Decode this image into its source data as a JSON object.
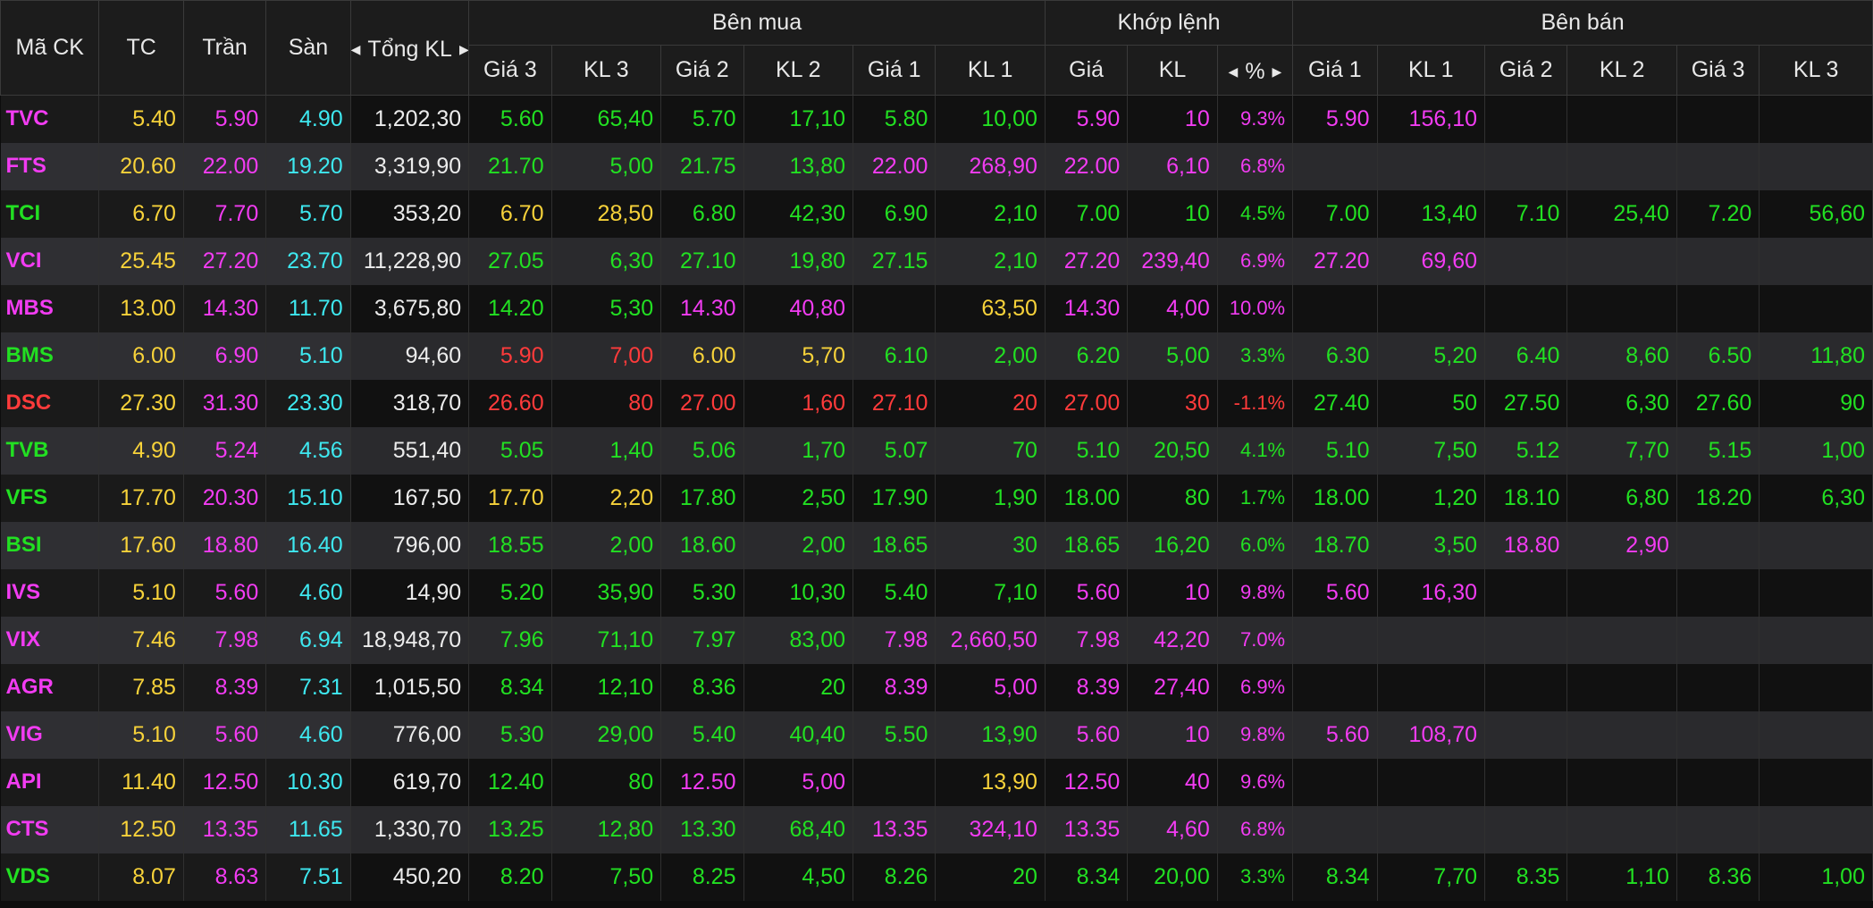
{
  "headers": {
    "symbol": "Mã CK",
    "ref": "TC",
    "ceiling": "Trần",
    "floor": "Sàn",
    "total_volume": "Tổng KL",
    "buy_group": "Bên mua",
    "match_group": "Khớp lệnh",
    "sell_group": "Bên bán",
    "buy_cols": [
      "Giá 3",
      "KL 3",
      "Giá 2",
      "KL 2",
      "Giá 1",
      "KL 1"
    ],
    "match_cols": [
      "Giá",
      "KL",
      "%"
    ],
    "sell_cols": [
      "Giá 1",
      "KL 1",
      "Giá 2",
      "KL 2",
      "Giá 3",
      "KL 3"
    ]
  },
  "icons": {
    "left": "arrow-left-icon",
    "right": "arrow-right-icon"
  },
  "colors": {
    "up": "#22e022",
    "down": "#ff3b3b",
    "ref": "#f7d23a",
    "ceiling": "#f23cf2",
    "floor": "#3ee8f0",
    "header_bg": "#1c1c1c",
    "row_dark": "#111111",
    "row_light": "#2a2a2d"
  },
  "rows": [
    {
      "s": "TVC",
      "sc": "c",
      "tc": "5.40",
      "tran": "5.90",
      "san": "4.90",
      "tkl": "1,202,30",
      "buy": [
        [
          "5.60",
          "u"
        ],
        [
          "65,40",
          "u"
        ],
        [
          "5.70",
          "u"
        ],
        [
          "17,10",
          "u"
        ],
        [
          "5.80",
          "u"
        ],
        [
          "10,00",
          "u"
        ]
      ],
      "match": [
        [
          "5.90",
          "c"
        ],
        [
          "10",
          "c"
        ],
        [
          "9.3%",
          "c"
        ]
      ],
      "sell": [
        [
          "5.90",
          "c"
        ],
        [
          "156,10",
          "c"
        ],
        [
          "",
          ""
        ],
        [
          "",
          ""
        ],
        [
          "",
          ""
        ],
        [
          "",
          ""
        ]
      ]
    },
    {
      "s": "FTS",
      "sc": "c",
      "tc": "20.60",
      "tran": "22.00",
      "san": "19.20",
      "tkl": "3,319,90",
      "buy": [
        [
          "21.70",
          "u"
        ],
        [
          "5,00",
          "u"
        ],
        [
          "21.75",
          "u"
        ],
        [
          "13,80",
          "u"
        ],
        [
          "22.00",
          "c"
        ],
        [
          "268,90",
          "c"
        ]
      ],
      "match": [
        [
          "22.00",
          "c"
        ],
        [
          "6,10",
          "c"
        ],
        [
          "6.8%",
          "c"
        ]
      ],
      "sell": [
        [
          "",
          ""
        ],
        [
          "",
          ""
        ],
        [
          "",
          ""
        ],
        [
          "",
          ""
        ],
        [
          "",
          ""
        ],
        [
          "",
          ""
        ]
      ]
    },
    {
      "s": "TCI",
      "sc": "u",
      "tc": "6.70",
      "tran": "7.70",
      "san": "5.70",
      "tkl": "353,20",
      "buy": [
        [
          "6.70",
          "r"
        ],
        [
          "28,50",
          "r"
        ],
        [
          "6.80",
          "u"
        ],
        [
          "42,30",
          "u"
        ],
        [
          "6.90",
          "u"
        ],
        [
          "2,10",
          "u"
        ]
      ],
      "match": [
        [
          "7.00",
          "u"
        ],
        [
          "10",
          "u"
        ],
        [
          "4.5%",
          "u"
        ]
      ],
      "sell": [
        [
          "7.00",
          "u"
        ],
        [
          "13,40",
          "u"
        ],
        [
          "7.10",
          "u"
        ],
        [
          "25,40",
          "u"
        ],
        [
          "7.20",
          "u"
        ],
        [
          "56,60",
          "u"
        ]
      ]
    },
    {
      "s": "VCI",
      "sc": "c",
      "tc": "25.45",
      "tran": "27.20",
      "san": "23.70",
      "tkl": "11,228,90",
      "buy": [
        [
          "27.05",
          "u"
        ],
        [
          "6,30",
          "u"
        ],
        [
          "27.10",
          "u"
        ],
        [
          "19,80",
          "u"
        ],
        [
          "27.15",
          "u"
        ],
        [
          "2,10",
          "u"
        ]
      ],
      "match": [
        [
          "27.20",
          "c"
        ],
        [
          "239,40",
          "c"
        ],
        [
          "6.9%",
          "c"
        ]
      ],
      "sell": [
        [
          "27.20",
          "c"
        ],
        [
          "69,60",
          "c"
        ],
        [
          "",
          ""
        ],
        [
          "",
          ""
        ],
        [
          "",
          ""
        ],
        [
          "",
          ""
        ]
      ]
    },
    {
      "s": "MBS",
      "sc": "c",
      "tc": "13.00",
      "tran": "14.30",
      "san": "11.70",
      "tkl": "3,675,80",
      "buy": [
        [
          "14.20",
          "u"
        ],
        [
          "5,30",
          "u"
        ],
        [
          "14.30",
          "c"
        ],
        [
          "40,80",
          "c"
        ],
        [
          "",
          ""
        ],
        [
          "63,50",
          "r"
        ]
      ],
      "match": [
        [
          "14.30",
          "c"
        ],
        [
          "4,00",
          "c"
        ],
        [
          "10.0%",
          "c"
        ]
      ],
      "sell": [
        [
          "",
          ""
        ],
        [
          "",
          ""
        ],
        [
          "",
          ""
        ],
        [
          "",
          ""
        ],
        [
          "",
          ""
        ],
        [
          "",
          ""
        ]
      ]
    },
    {
      "s": "BMS",
      "sc": "u",
      "tc": "6.00",
      "tran": "6.90",
      "san": "5.10",
      "tkl": "94,60",
      "buy": [
        [
          "5.90",
          "d"
        ],
        [
          "7,00",
          "d"
        ],
        [
          "6.00",
          "r"
        ],
        [
          "5,70",
          "r"
        ],
        [
          "6.10",
          "u"
        ],
        [
          "2,00",
          "u"
        ]
      ],
      "match": [
        [
          "6.20",
          "u"
        ],
        [
          "5,00",
          "u"
        ],
        [
          "3.3%",
          "u"
        ]
      ],
      "sell": [
        [
          "6.30",
          "u"
        ],
        [
          "5,20",
          "u"
        ],
        [
          "6.40",
          "u"
        ],
        [
          "8,60",
          "u"
        ],
        [
          "6.50",
          "u"
        ],
        [
          "11,80",
          "u"
        ]
      ]
    },
    {
      "s": "DSC",
      "sc": "d",
      "tc": "27.30",
      "tran": "31.30",
      "san": "23.30",
      "tkl": "318,70",
      "buy": [
        [
          "26.60",
          "d"
        ],
        [
          "80",
          "d"
        ],
        [
          "27.00",
          "d"
        ],
        [
          "1,60",
          "d"
        ],
        [
          "27.10",
          "d"
        ],
        [
          "20",
          "d"
        ]
      ],
      "match": [
        [
          "27.00",
          "d"
        ],
        [
          "30",
          "d"
        ],
        [
          "-1.1%",
          "d"
        ]
      ],
      "sell": [
        [
          "27.40",
          "u"
        ],
        [
          "50",
          "u"
        ],
        [
          "27.50",
          "u"
        ],
        [
          "6,30",
          "u"
        ],
        [
          "27.60",
          "u"
        ],
        [
          "90",
          "u"
        ]
      ]
    },
    {
      "s": "TVB",
      "sc": "u",
      "tc": "4.90",
      "tran": "5.24",
      "san": "4.56",
      "tkl": "551,40",
      "buy": [
        [
          "5.05",
          "u"
        ],
        [
          "1,40",
          "u"
        ],
        [
          "5.06",
          "u"
        ],
        [
          "1,70",
          "u"
        ],
        [
          "5.07",
          "u"
        ],
        [
          "70",
          "u"
        ]
      ],
      "match": [
        [
          "5.10",
          "u"
        ],
        [
          "20,50",
          "u"
        ],
        [
          "4.1%",
          "u"
        ]
      ],
      "sell": [
        [
          "5.10",
          "u"
        ],
        [
          "7,50",
          "u"
        ],
        [
          "5.12",
          "u"
        ],
        [
          "7,70",
          "u"
        ],
        [
          "5.15",
          "u"
        ],
        [
          "1,00",
          "u"
        ]
      ]
    },
    {
      "s": "VFS",
      "sc": "u",
      "tc": "17.70",
      "tran": "20.30",
      "san": "15.10",
      "tkl": "167,50",
      "buy": [
        [
          "17.70",
          "r"
        ],
        [
          "2,20",
          "r"
        ],
        [
          "17.80",
          "u"
        ],
        [
          "2,50",
          "u"
        ],
        [
          "17.90",
          "u"
        ],
        [
          "1,90",
          "u"
        ]
      ],
      "match": [
        [
          "18.00",
          "u"
        ],
        [
          "80",
          "u"
        ],
        [
          "1.7%",
          "u"
        ]
      ],
      "sell": [
        [
          "18.00",
          "u"
        ],
        [
          "1,20",
          "u"
        ],
        [
          "18.10",
          "u"
        ],
        [
          "6,80",
          "u"
        ],
        [
          "18.20",
          "u"
        ],
        [
          "6,30",
          "u"
        ]
      ]
    },
    {
      "s": "BSI",
      "sc": "u",
      "tc": "17.60",
      "tran": "18.80",
      "san": "16.40",
      "tkl": "796,00",
      "buy": [
        [
          "18.55",
          "u"
        ],
        [
          "2,00",
          "u"
        ],
        [
          "18.60",
          "u"
        ],
        [
          "2,00",
          "u"
        ],
        [
          "18.65",
          "u"
        ],
        [
          "30",
          "u"
        ]
      ],
      "match": [
        [
          "18.65",
          "u"
        ],
        [
          "16,20",
          "u"
        ],
        [
          "6.0%",
          "u"
        ]
      ],
      "sell": [
        [
          "18.70",
          "u"
        ],
        [
          "3,50",
          "u"
        ],
        [
          "18.80",
          "c"
        ],
        [
          "2,90",
          "c"
        ],
        [
          "",
          ""
        ],
        [
          "",
          ""
        ]
      ]
    },
    {
      "s": "IVS",
      "sc": "c",
      "tc": "5.10",
      "tran": "5.60",
      "san": "4.60",
      "tkl": "14,90",
      "buy": [
        [
          "5.20",
          "u"
        ],
        [
          "35,90",
          "u"
        ],
        [
          "5.30",
          "u"
        ],
        [
          "10,30",
          "u"
        ],
        [
          "5.40",
          "u"
        ],
        [
          "7,10",
          "u"
        ]
      ],
      "match": [
        [
          "5.60",
          "c"
        ],
        [
          "10",
          "c"
        ],
        [
          "9.8%",
          "c"
        ]
      ],
      "sell": [
        [
          "5.60",
          "c"
        ],
        [
          "16,30",
          "c"
        ],
        [
          "",
          ""
        ],
        [
          "",
          ""
        ],
        [
          "",
          ""
        ],
        [
          "",
          ""
        ]
      ]
    },
    {
      "s": "VIX",
      "sc": "c",
      "tc": "7.46",
      "tran": "7.98",
      "san": "6.94",
      "tkl": "18,948,70",
      "buy": [
        [
          "7.96",
          "u"
        ],
        [
          "71,10",
          "u"
        ],
        [
          "7.97",
          "u"
        ],
        [
          "83,00",
          "u"
        ],
        [
          "7.98",
          "c"
        ],
        [
          "2,660,50",
          "c"
        ]
      ],
      "match": [
        [
          "7.98",
          "c"
        ],
        [
          "42,20",
          "c"
        ],
        [
          "7.0%",
          "c"
        ]
      ],
      "sell": [
        [
          "",
          ""
        ],
        [
          "",
          ""
        ],
        [
          "",
          ""
        ],
        [
          "",
          ""
        ],
        [
          "",
          ""
        ],
        [
          "",
          ""
        ]
      ]
    },
    {
      "s": "AGR",
      "sc": "c",
      "tc": "7.85",
      "tran": "8.39",
      "san": "7.31",
      "tkl": "1,015,50",
      "buy": [
        [
          "8.34",
          "u"
        ],
        [
          "12,10",
          "u"
        ],
        [
          "8.36",
          "u"
        ],
        [
          "20",
          "u"
        ],
        [
          "8.39",
          "c"
        ],
        [
          "5,00",
          "c"
        ]
      ],
      "match": [
        [
          "8.39",
          "c"
        ],
        [
          "27,40",
          "c"
        ],
        [
          "6.9%",
          "c"
        ]
      ],
      "sell": [
        [
          "",
          ""
        ],
        [
          "",
          ""
        ],
        [
          "",
          ""
        ],
        [
          "",
          ""
        ],
        [
          "",
          ""
        ],
        [
          "",
          ""
        ]
      ]
    },
    {
      "s": "VIG",
      "sc": "c",
      "tc": "5.10",
      "tran": "5.60",
      "san": "4.60",
      "tkl": "776,00",
      "buy": [
        [
          "5.30",
          "u"
        ],
        [
          "29,00",
          "u"
        ],
        [
          "5.40",
          "u"
        ],
        [
          "40,40",
          "u"
        ],
        [
          "5.50",
          "u"
        ],
        [
          "13,90",
          "u"
        ]
      ],
      "match": [
        [
          "5.60",
          "c"
        ],
        [
          "10",
          "c"
        ],
        [
          "9.8%",
          "c"
        ]
      ],
      "sell": [
        [
          "5.60",
          "c"
        ],
        [
          "108,70",
          "c"
        ],
        [
          "",
          ""
        ],
        [
          "",
          ""
        ],
        [
          "",
          ""
        ],
        [
          "",
          ""
        ]
      ]
    },
    {
      "s": "API",
      "sc": "c",
      "tc": "11.40",
      "tran": "12.50",
      "san": "10.30",
      "tkl": "619,70",
      "buy": [
        [
          "12.40",
          "u"
        ],
        [
          "80",
          "u"
        ],
        [
          "12.50",
          "c"
        ],
        [
          "5,00",
          "c"
        ],
        [
          "",
          ""
        ],
        [
          "13,90",
          "r"
        ]
      ],
      "match": [
        [
          "12.50",
          "c"
        ],
        [
          "40",
          "c"
        ],
        [
          "9.6%",
          "c"
        ]
      ],
      "sell": [
        [
          "",
          ""
        ],
        [
          "",
          ""
        ],
        [
          "",
          ""
        ],
        [
          "",
          ""
        ],
        [
          "",
          ""
        ],
        [
          "",
          ""
        ]
      ]
    },
    {
      "s": "CTS",
      "sc": "c",
      "tc": "12.50",
      "tran": "13.35",
      "san": "11.65",
      "tkl": "1,330,70",
      "buy": [
        [
          "13.25",
          "u"
        ],
        [
          "12,80",
          "u"
        ],
        [
          "13.30",
          "u"
        ],
        [
          "68,40",
          "u"
        ],
        [
          "13.35",
          "c"
        ],
        [
          "324,10",
          "c"
        ]
      ],
      "match": [
        [
          "13.35",
          "c"
        ],
        [
          "4,60",
          "c"
        ],
        [
          "6.8%",
          "c"
        ]
      ],
      "sell": [
        [
          "",
          ""
        ],
        [
          "",
          ""
        ],
        [
          "",
          ""
        ],
        [
          "",
          ""
        ],
        [
          "",
          ""
        ],
        [
          "",
          ""
        ]
      ]
    },
    {
      "s": "VDS",
      "sc": "u",
      "tc": "8.07",
      "tran": "8.63",
      "san": "7.51",
      "tkl": "450,20",
      "buy": [
        [
          "8.20",
          "u"
        ],
        [
          "7,50",
          "u"
        ],
        [
          "8.25",
          "u"
        ],
        [
          "4,50",
          "u"
        ],
        [
          "8.26",
          "u"
        ],
        [
          "20",
          "u"
        ]
      ],
      "match": [
        [
          "8.34",
          "u"
        ],
        [
          "20,00",
          "u"
        ],
        [
          "3.3%",
          "u"
        ]
      ],
      "sell": [
        [
          "8.34",
          "u"
        ],
        [
          "7,70",
          "u"
        ],
        [
          "8.35",
          "u"
        ],
        [
          "1,10",
          "u"
        ],
        [
          "8.36",
          "u"
        ],
        [
          "1,00",
          "u"
        ]
      ]
    }
  ]
}
